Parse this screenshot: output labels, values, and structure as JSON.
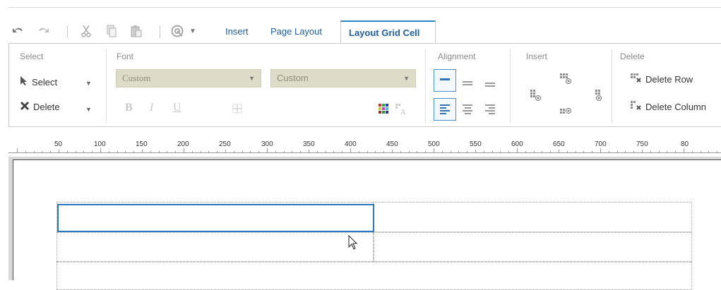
{
  "toolbar": {
    "undo_icon": "undo-icon",
    "redo_icon": "redo-icon",
    "cut_icon": "cut-icon",
    "copy_icon": "copy-icon",
    "paste_icon": "paste-icon",
    "target_icon": "target-icon"
  },
  "tabs": [
    {
      "label": "Insert"
    },
    {
      "label": "Page Layout"
    },
    {
      "label": "Layout Grid Cell"
    }
  ],
  "ribbon": {
    "select_group": {
      "title": "Select",
      "select_label": "Select",
      "delete_label": "Delete"
    },
    "font_group": {
      "title": "Font",
      "font1": "Custom",
      "font2": "Custom",
      "bold": "B",
      "italic": "I",
      "underline": "U"
    },
    "alignment_group": {
      "title": "Alignment"
    },
    "insert_group": {
      "title": "Insert"
    },
    "delete_group": {
      "title": "Delete",
      "delete_row": "Delete Row",
      "delete_column": "Delete Column"
    }
  },
  "ruler": {
    "labels": [
      "50",
      "100",
      "150",
      "200",
      "250",
      "300",
      "350",
      "400",
      "450",
      "500",
      "550",
      "600",
      "650",
      "700",
      "750",
      "80"
    ]
  },
  "colors": {
    "accent": "#2a76c0",
    "tab_active_border": "#2c83c7",
    "font_select_bg": "#dcdcc8"
  }
}
